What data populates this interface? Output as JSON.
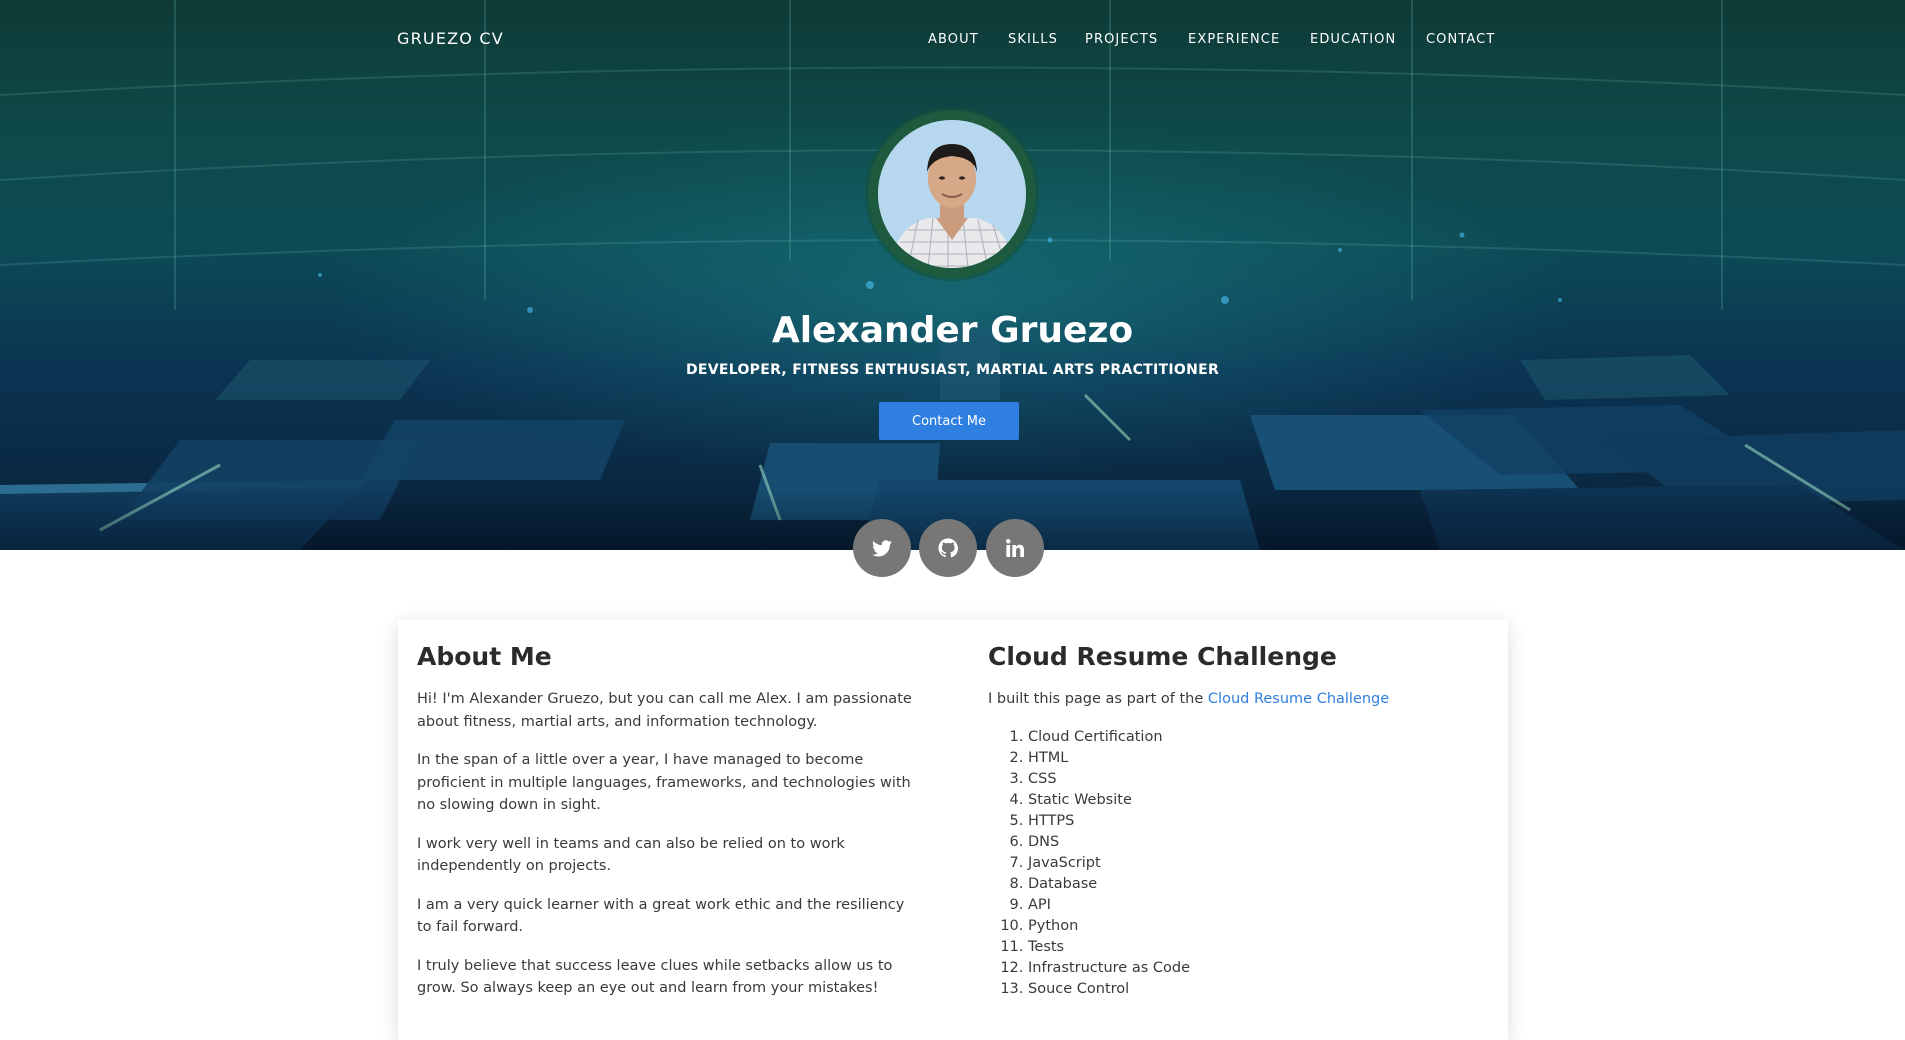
{
  "brand": "GRUEZO CV",
  "nav": {
    "items": [
      "ABOUT",
      "SKILLS",
      "PROJECTS",
      "EXPERIENCE",
      "EDUCATION",
      "CONTACT"
    ]
  },
  "hero": {
    "name": "Alexander Gruezo",
    "subtitle": "DEVELOPER, FITNESS ENTHUSIAST, MARTIAL ARTS PRACTITIONER",
    "contact_button": "Contact Me"
  },
  "social": {
    "icons": [
      "twitter-icon",
      "github-icon",
      "linkedin-icon"
    ]
  },
  "about": {
    "title": "About Me",
    "paragraphs": [
      "Hi! I'm Alexander Gruezo, but you can call me Alex. I am passionate about fitness, martial arts, and information technology.",
      "In the span of a little over a year, I have managed to become proficient in multiple languages, frameworks, and technologies with no slowing down in sight.",
      "I work very well in teams and can also be relied on to work independently on projects.",
      "I am a very quick learner with a great work ethic and the resiliency to fail forward.",
      "I truly believe that success leave clues while setbacks allow us to grow. So always keep an eye out and learn from your mistakes!"
    ]
  },
  "crc": {
    "title": "Cloud Resume Challenge",
    "intro": "I built this page as part of the ",
    "link": "Cloud Resume Challenge",
    "items": [
      "Cloud Certification",
      "HTML",
      "CSS",
      "Static Website",
      "HTTPS",
      "DNS",
      "JavaScript",
      "Database",
      "API",
      "Python",
      "Tests",
      "Infrastructure as Code",
      "Souce Control"
    ]
  },
  "colors": {
    "accent": "#2f7fe0",
    "social_bg": "#777777",
    "hero_dark": "#0b3352"
  }
}
